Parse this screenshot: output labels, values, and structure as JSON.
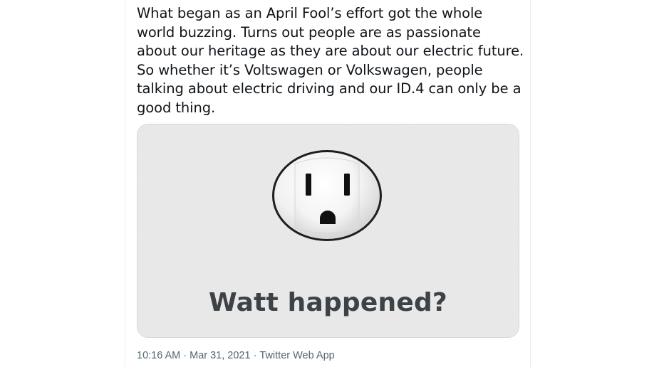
{
  "tweet": {
    "text_lines": [
      "What began as an April Fool’s effort got the whole",
      "world buzzing. Turns out people are as passionate",
      "about our heritage as they are about our electric future.",
      "So whether it’s Voltswagen or Volkswagen, people",
      "talking about electric driving and our ID.4 can only be a",
      "good thing."
    ],
    "media": {
      "caption": "Watt happened?",
      "icon": "electrical-outlet-icon",
      "background_color": "#ececec",
      "caption_color": "#3d4246"
    },
    "meta": {
      "time": "10:16 AM",
      "separator": "·",
      "date": "Mar 31, 2021",
      "source": "Twitter Web App"
    }
  }
}
